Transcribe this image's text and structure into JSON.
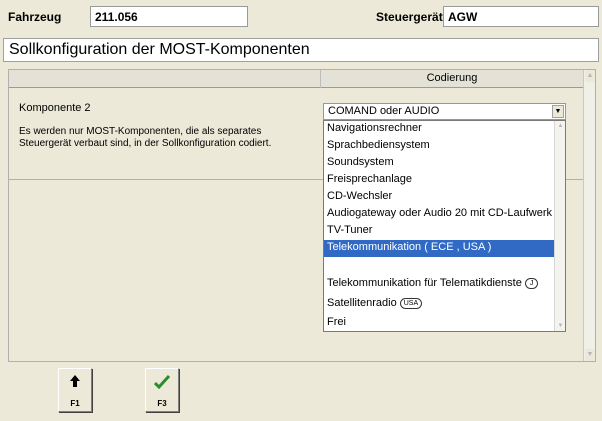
{
  "header": {
    "vehicle_label": "Fahrzeug",
    "vehicle_value": "211.056",
    "ecu_label": "Steuergerät",
    "ecu_value": "AGW"
  },
  "section_title": "Sollkonfiguration der MOST-Komponenten",
  "table": {
    "column_header": "Codierung",
    "row": {
      "label": "Komponente 2",
      "note": "Es werden nur MOST-Komponenten, die als separates Steuergerät verbaut sind, in der Sollkonfiguration codiert."
    }
  },
  "select": {
    "selected_value": "COMAND oder AUDIO",
    "options": [
      {
        "label": "Navigationsrechner"
      },
      {
        "label": "Sprachbediensystem"
      },
      {
        "label": "Soundsystem"
      },
      {
        "label": "Freisprechanlage"
      },
      {
        "label": "CD-Wechsler"
      },
      {
        "label": "Audiogateway oder Audio 20 mit CD-Laufwerk"
      },
      {
        "label": "TV-Tuner"
      },
      {
        "label": "Telekommunikation ( ECE , USA )",
        "selected": true
      },
      {
        "label": ""
      },
      {
        "label": "Telekommunikation für Telematikdienste",
        "badge": "J"
      },
      {
        "label": "Satellitenradio",
        "badge": "USA"
      },
      {
        "label": "Frei"
      }
    ]
  },
  "function_keys": [
    {
      "label": "F1",
      "icon": "arrow-up-icon"
    },
    {
      "label": "F3",
      "icon": "checkmark-icon"
    }
  ],
  "colors": {
    "selection_bg": "#316ac5",
    "window_bg": "#ece9d8",
    "checkmark": "#2e8b2e"
  }
}
